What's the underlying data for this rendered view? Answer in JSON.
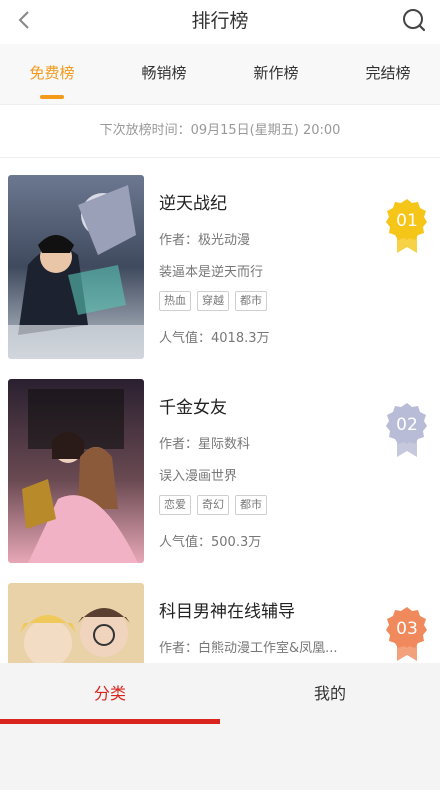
{
  "header": {
    "title": "排行榜",
    "back_icon": "chevron-left-icon",
    "search_icon": "search-icon"
  },
  "tabs": [
    {
      "label": "免费榜",
      "active": true
    },
    {
      "label": "畅销榜",
      "active": false
    },
    {
      "label": "新作榜",
      "active": false
    },
    {
      "label": "完结榜",
      "active": false
    }
  ],
  "notice": "下次放榜时间：09月15日(星期五) 20:00",
  "items": [
    {
      "rank": "01",
      "name": "逆天战纪",
      "author": "作者：极光动漫",
      "desc": "装逼本是逆天而行",
      "tags": [
        "热血",
        "穿越",
        "都市"
      ],
      "popularity": "人气值：4018.3万",
      "badge_color": "#f5c518"
    },
    {
      "rank": "02",
      "name": "千金女友",
      "author": "作者：星际数科",
      "desc": "误入漫画世界",
      "tags": [
        "恋爱",
        "奇幻",
        "都市"
      ],
      "popularity": "人气值：500.3万",
      "badge_color": "#b8bcd6"
    },
    {
      "rank": "03",
      "name": "科目男神在线辅导",
      "author": "作者：白熊动漫工作室&凤凰...",
      "desc": "",
      "tags": [],
      "popularity": "",
      "badge_color": "#f08a5d"
    }
  ],
  "bottom_nav": [
    {
      "label": "分类",
      "active": true
    },
    {
      "label": "我的",
      "active": false
    }
  ],
  "colors": {
    "accent": "#f39a1b",
    "nav_accent": "#d9251d"
  }
}
